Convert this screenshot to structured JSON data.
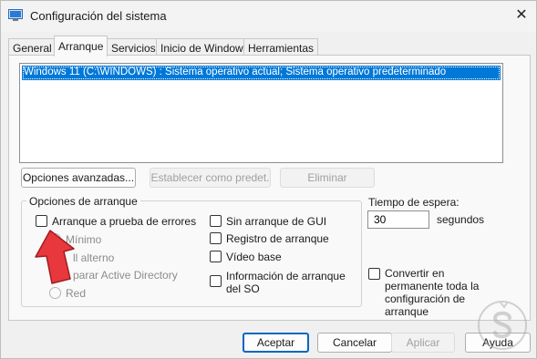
{
  "window": {
    "title": "Configuración del sistema",
    "close_symbol": "✕"
  },
  "tabs": [
    {
      "label": "General"
    },
    {
      "label": "Arranque",
      "active": true
    },
    {
      "label": "Servicios"
    },
    {
      "label": "Inicio de Windows"
    },
    {
      "label": "Herramientas"
    }
  ],
  "os_list": {
    "selected_item": "Windows 11 (C:\\WINDOWS) : Sistema operativo actual; Sistema operativo predeterminado"
  },
  "os_buttons": {
    "advanced": "Opciones avanzadas...",
    "set_default": "Establecer como predet.",
    "delete": "Eliminar"
  },
  "boot_options": {
    "group_label": "Opciones de arranque",
    "safe_boot": "Arranque a prueba de errores",
    "minimal": "Mínimo",
    "alternate_shell": "ll alterno",
    "active_directory": "parar Active Directory",
    "network": "Red",
    "no_gui": "Sin arranque de GUI",
    "boot_log": "Registro de arranque",
    "base_video": "Vídeo base",
    "os_boot_info": "Información de arranque del SO"
  },
  "timeout": {
    "label": "Tiempo de espera:",
    "value": "30",
    "unit": "segundos"
  },
  "make_permanent": "Convertir en permanente toda la configuración de arranque",
  "footer": {
    "ok": "Aceptar",
    "cancel": "Cancelar",
    "apply": "Aplicar",
    "help": "Ayuda"
  },
  "colors": {
    "selection": "#0078d7",
    "arrow": "#e8383d",
    "primary_border": "#0067c0"
  }
}
